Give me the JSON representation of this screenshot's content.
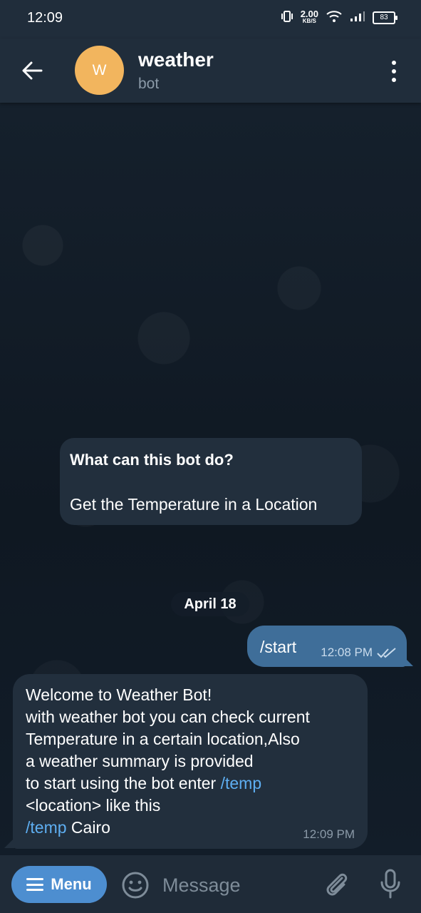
{
  "status_bar": {
    "time": "12:09",
    "network_speed": "2.00",
    "network_unit": "KB/S",
    "battery": "83"
  },
  "header": {
    "avatar_letter": "W",
    "title": "weather",
    "subtitle": "bot",
    "avatar_color": "#f2b55e"
  },
  "bot_info": {
    "question": "What can this bot do?",
    "answer": "Get the Temperature in a Location"
  },
  "date_separator": "April 18",
  "messages": [
    {
      "direction": "outgoing",
      "text": "/start",
      "time": "12:08 PM",
      "status": "read"
    },
    {
      "direction": "incoming",
      "lines": [
        "Welcome to Weather Bot!",
        "with weather bot you can check current",
        "Temperature in a certain location,Also",
        "a weather summary is provided",
        "to start using the bot enter ",
        "/temp",
        "<location> like this",
        "/temp",
        " Cairo"
      ],
      "time": "12:09 PM"
    }
  ],
  "composer": {
    "menu_label": "Menu",
    "placeholder": "Message"
  },
  "icons": {
    "back": "back-arrow-icon",
    "more": "more-vertical-icon",
    "emoji": "emoji-icon",
    "attach": "paperclip-icon",
    "mic": "microphone-icon",
    "read_check": "double-check-icon"
  },
  "colors": {
    "accent": "#4d8ed0",
    "outgoing_bubble": "#3f6e99",
    "incoming_bubble": "#222f3d",
    "link": "#5eaef1"
  }
}
